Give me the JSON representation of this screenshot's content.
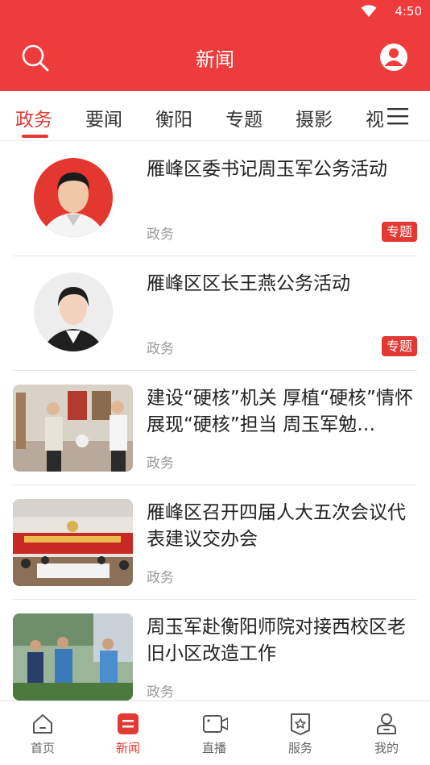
{
  "status": {
    "time": "4:50"
  },
  "header": {
    "title": "新闻"
  },
  "tabs": [
    {
      "label": "政务",
      "active": true
    },
    {
      "label": "要闻",
      "active": false
    },
    {
      "label": "衡阳",
      "active": false
    },
    {
      "label": "专题",
      "active": false
    },
    {
      "label": "摄影",
      "active": false
    },
    {
      "label": "视",
      "active": false
    }
  ],
  "news": [
    {
      "title": "雁峰区委书记周玉军公务活动",
      "category": "政务",
      "badge": "专题",
      "image": "round-portrait-man"
    },
    {
      "title": "雁峰区区长王燕公务活动",
      "category": "政务",
      "badge": "专题",
      "image": "round-portrait-woman"
    },
    {
      "title": "建设“硬核”机关 厚植“硬核”情怀 展现“硬核”担当 周玉军勉…",
      "category": "政务",
      "image": "photo-office-visit"
    },
    {
      "title": "雁峰区召开四届人大五次会议代表建议交办会",
      "category": "政务",
      "image": "photo-meeting"
    },
    {
      "title": "周玉军赴衡阳师院对接西校区老旧小区改造工作",
      "category": "政务",
      "image": "photo-outdoor-inspection"
    }
  ],
  "bottom_nav": [
    {
      "label": "首页",
      "icon": "home-icon",
      "active": false
    },
    {
      "label": "新闻",
      "icon": "news-icon",
      "active": true
    },
    {
      "label": "直播",
      "icon": "live-camera-icon",
      "active": false
    },
    {
      "label": "服务",
      "icon": "service-star-icon",
      "active": false
    },
    {
      "label": "我的",
      "icon": "profile-icon",
      "active": false
    }
  ],
  "colors": {
    "brand_red": "#ee3b3b",
    "accent_red": "#e23a33",
    "muted_text": "#9a9a9a"
  }
}
